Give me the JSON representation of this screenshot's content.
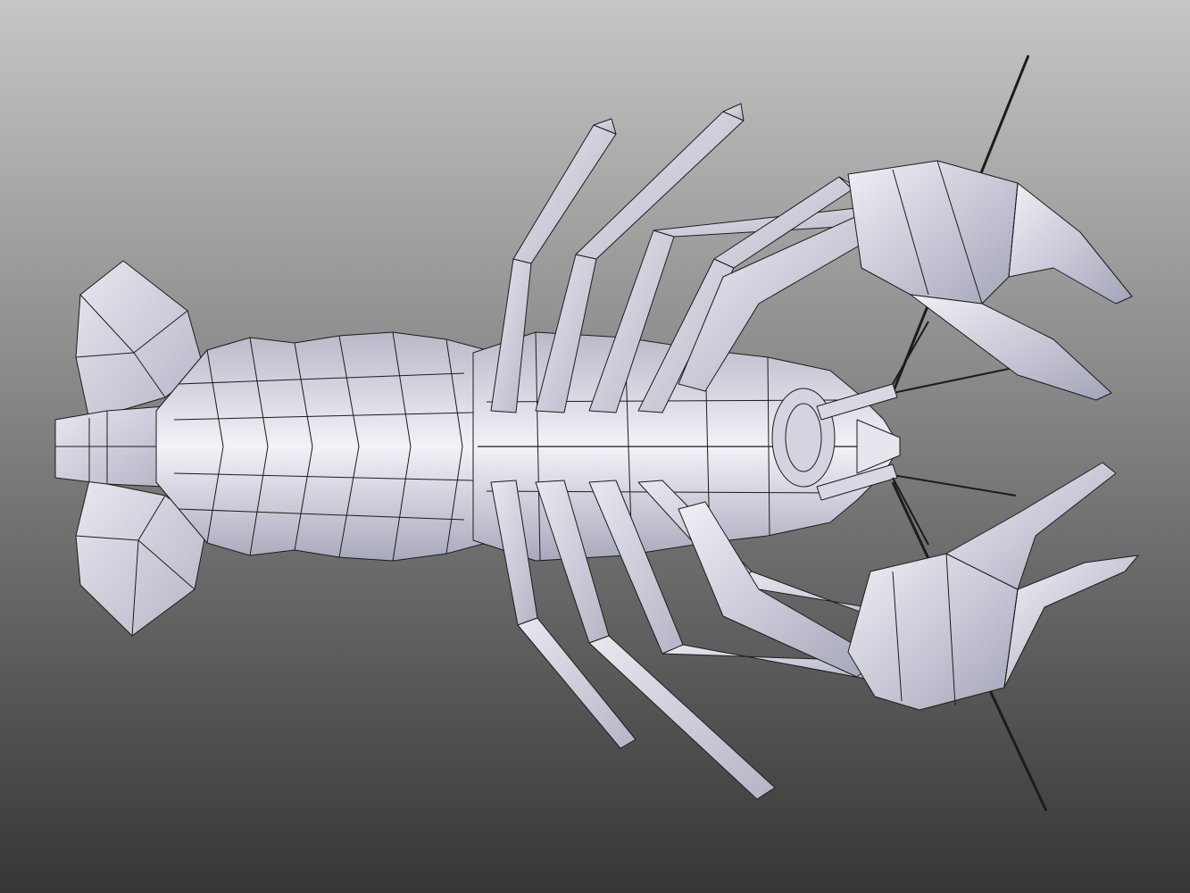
{
  "viewport": {
    "background_top": "#c6c6c6",
    "background_bottom": "#363636",
    "model_fill": "#dcdce6",
    "model_highlight": "#f2f2f8",
    "model_shade": "#a0a0b4",
    "wire_color": "#1c1c1c"
  },
  "model": {
    "subject": "crayfish-low-poly-mesh",
    "display_mode": "shaded-wireframe"
  }
}
